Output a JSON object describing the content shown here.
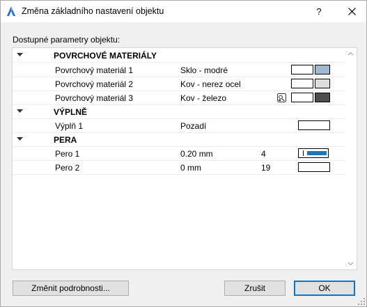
{
  "window": {
    "title": "Změna základního nastavení objektu",
    "help_label": "?"
  },
  "section_caption": "Dostupné parametry objektu:",
  "groups": {
    "materials": {
      "title": "POVRCHOVÉ MATERIÁLY",
      "rows": [
        {
          "name": "Povrchový materiál 1",
          "value": "Sklo - modré",
          "swatch_color": "#9fb8d4"
        },
        {
          "name": "Povrchový materiál 2",
          "value": "Kov - nerez ocel",
          "swatch_color": "#dddcdf"
        },
        {
          "name": "Povrchový materiál 3",
          "value": "Kov - železo",
          "swatch_color": "#4d4d4d",
          "icon": "material-picker-icon"
        }
      ]
    },
    "fills": {
      "title": "VÝPLNĚ",
      "rows": [
        {
          "name": "Výplň 1",
          "value": "Pozadí"
        }
      ]
    },
    "pens": {
      "title": "PERA",
      "rows": [
        {
          "name": "Pero 1",
          "value": "0.20 mm",
          "number": "4",
          "pen_color": "#1e78b8"
        },
        {
          "name": "Pero 2",
          "value": "0 mm",
          "number": "19"
        }
      ]
    }
  },
  "buttons": {
    "details": "Změnit podrobnosti...",
    "cancel": "Zrušit",
    "ok": "OK"
  },
  "colors": {
    "accent": "#0078d7",
    "title_icon": "#1e6fd0"
  }
}
